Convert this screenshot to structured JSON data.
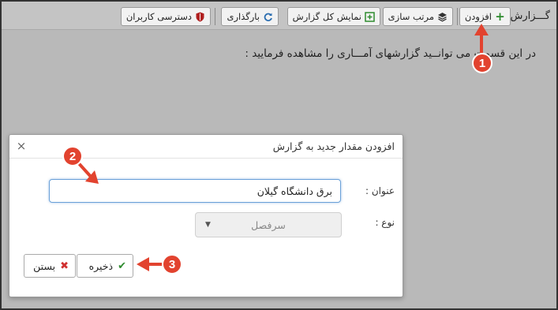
{
  "toolbar": {
    "title": "گـــزارش :",
    "buttons": [
      {
        "label": "افزودن",
        "icon": "plus-icon",
        "color": "#2e8b2e"
      },
      {
        "label": "مرتب سازی",
        "icon": "layers-icon",
        "color": "#333333"
      },
      {
        "label": "نمایش کل گزارش",
        "icon": "expand-icon",
        "color": "#2e8b2e"
      },
      {
        "label": "بارگذاری",
        "icon": "refresh-icon",
        "color": "#2a6db0"
      },
      {
        "label": "دسترسی کاربران",
        "icon": "shield-icon",
        "color": "#b02020"
      }
    ]
  },
  "intro_text": "در این قسمت می توانــید گزارشهای آمـــاری را مشاهده فرمایید :",
  "modal": {
    "title": "افزودن مقدار جدید به گزارش",
    "close_icon": "×",
    "fields": {
      "title_label": "عنوان :",
      "title_value": "برق دانشگاه گیلان",
      "type_label": "نوع :",
      "type_value": "سرفصل"
    },
    "buttons": {
      "save_label": "ذخیره",
      "close_label": "بستن"
    }
  },
  "annotations": [
    {
      "number": "1"
    },
    {
      "number": "2"
    },
    {
      "number": "3"
    }
  ]
}
